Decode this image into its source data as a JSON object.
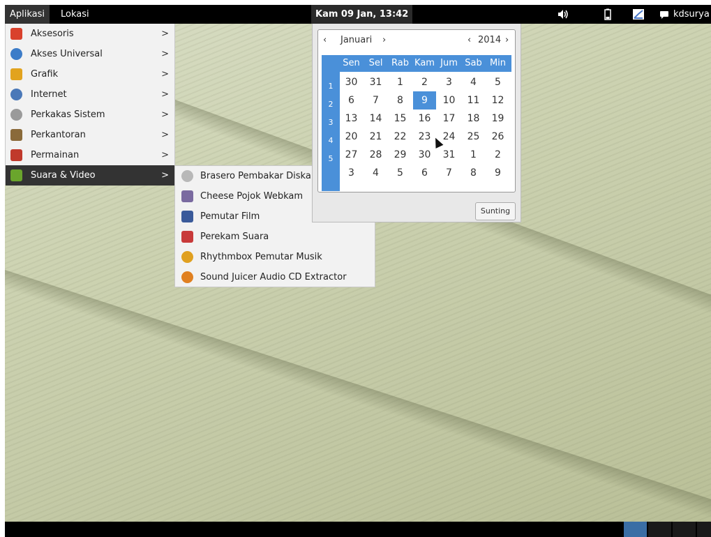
{
  "topbar": {
    "applications": "Aplikasi",
    "places": "Lokasi",
    "clock": "Kam 09 Jan, 13:42",
    "user": "kdsurya",
    "icons": [
      "volume-icon",
      "battery-icon",
      "network-icon",
      "chat-icon"
    ]
  },
  "apps_menu": {
    "items": [
      {
        "label": "Aksesoris",
        "icon": "accessories-icon",
        "color": "#d9412c"
      },
      {
        "label": "Akses Universal",
        "icon": "universal-access-icon",
        "color": "#3c7cc8"
      },
      {
        "label": "Grafik",
        "icon": "graphics-icon",
        "color": "#e2a31e"
      },
      {
        "label": "Internet",
        "icon": "internet-icon",
        "color": "#4a78b8"
      },
      {
        "label": "Perkakas Sistem",
        "icon": "system-tools-icon",
        "color": "#9a9a9a"
      },
      {
        "label": "Perkantoran",
        "icon": "office-icon",
        "color": "#8a6a3a"
      },
      {
        "label": "Permainan",
        "icon": "games-icon",
        "color": "#c0392b"
      },
      {
        "label": "Suara & Video",
        "icon": "sound-video-icon",
        "color": "#6aa52c"
      }
    ],
    "active_index": 7
  },
  "sub_menu": {
    "items": [
      {
        "label": "Brasero Pembakar Diska",
        "icon": "brasero-icon",
        "color": "#b8b8b8"
      },
      {
        "label": "Cheese Pojok Webkam",
        "icon": "cheese-icon",
        "color": "#7a6aa0"
      },
      {
        "label": "Pemutar Film",
        "icon": "totem-icon",
        "color": "#3a5a9a"
      },
      {
        "label": "Perekam Suara",
        "icon": "sound-recorder-icon",
        "color": "#c83a3a"
      },
      {
        "label": "Rhythmbox Pemutar Musik",
        "icon": "rhythmbox-icon",
        "color": "#e0a020"
      },
      {
        "label": "Sound Juicer Audio CD Extractor",
        "icon": "sound-juicer-icon",
        "color": "#e08020"
      }
    ]
  },
  "calendar": {
    "prev": "‹",
    "month": "Januari",
    "month_next": "›",
    "year_prev": "‹",
    "year": "2014",
    "year_next": "›",
    "day_names": [
      "Sen",
      "Sel",
      "Rab",
      "Kam",
      "Jum",
      "Sab",
      "Min"
    ],
    "week_numbers": [
      "1",
      "2",
      "3",
      "4",
      "5"
    ],
    "days": [
      [
        "30",
        "31",
        "1",
        "2",
        "3",
        "4",
        "5"
      ],
      [
        "6",
        "7",
        "8",
        "9",
        "10",
        "11",
        "12"
      ],
      [
        "13",
        "14",
        "15",
        "16",
        "17",
        "18",
        "19"
      ],
      [
        "20",
        "21",
        "22",
        "23",
        "24",
        "25",
        "26"
      ],
      [
        "27",
        "28",
        "29",
        "30",
        "31",
        "1",
        "2"
      ],
      [
        "3",
        "4",
        "5",
        "6",
        "7",
        "8",
        "9"
      ]
    ],
    "selected_day": "9",
    "edit_button": "Sunting",
    "accent": "#4a90d9"
  }
}
